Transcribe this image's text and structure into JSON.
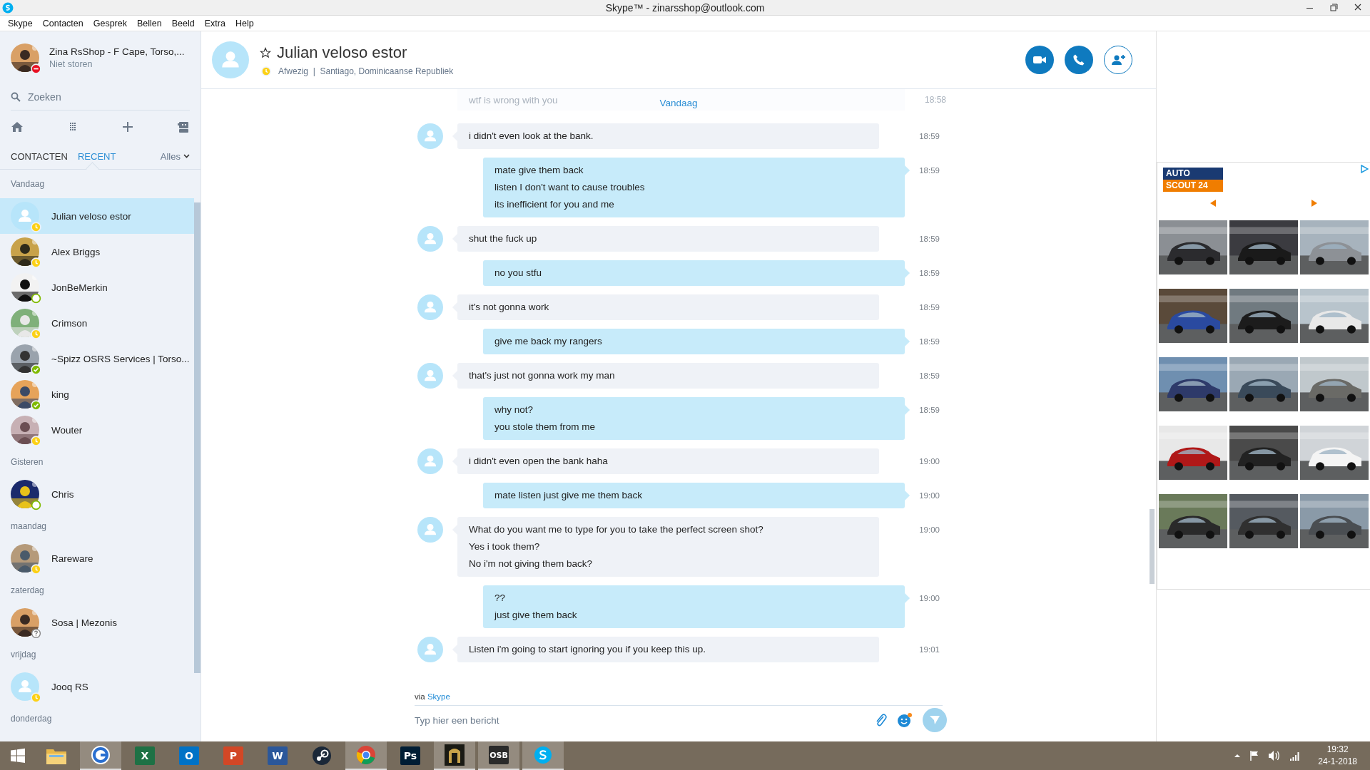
{
  "window": {
    "title": "Skype™ - zinarsshop@outlook.com"
  },
  "menu": [
    "Skype",
    "Contacten",
    "Gesprek",
    "Bellen",
    "Beeld",
    "Extra",
    "Help"
  ],
  "profile": {
    "name": "Zina RsShop - F Cape, Torso,...",
    "status_text": "Niet storen",
    "badge": {
      "kind": "dnd"
    }
  },
  "search": {
    "placeholder": "Zoeken"
  },
  "tabs": [
    {
      "label": "CONTACTEN",
      "selected": false
    },
    {
      "label": "RECENT",
      "selected": true
    }
  ],
  "filter": "Alles",
  "groups": [
    {
      "label": "Vandaag",
      "contacts": [
        {
          "name": "Julian veloso estor",
          "avatar": {
            "kind": "default"
          },
          "badge": {
            "kind": "away"
          },
          "selected": true
        },
        {
          "name": "Alex Briggs",
          "badge": {
            "kind": "away"
          },
          "selected": false
        },
        {
          "name": "JonBeMerkin",
          "badge": {
            "kind": "available"
          },
          "selected": false
        },
        {
          "name": "Crimson",
          "badge": {
            "kind": "away"
          },
          "selected": false
        },
        {
          "name": "~Spizz OSRS Services | Torso...",
          "badge": {
            "kind": "online"
          },
          "selected": false
        },
        {
          "name": "king",
          "badge": {
            "kind": "online"
          },
          "selected": false
        },
        {
          "name": "Wouter",
          "badge": {
            "kind": "away"
          },
          "selected": false
        }
      ]
    },
    {
      "label": "Gisteren",
      "contacts": [
        {
          "name": "Chris",
          "badge": {
            "kind": "available"
          },
          "selected": false
        }
      ]
    },
    {
      "label": "maandag",
      "contacts": [
        {
          "name": "Rareware",
          "badge": {
            "kind": "away"
          },
          "selected": false
        }
      ]
    },
    {
      "label": "zaterdag",
      "contacts": [
        {
          "name": "Sosa | Mezonis",
          "badge": {
            "kind": "unknown"
          },
          "selected": false
        }
      ]
    },
    {
      "label": "vrijdag",
      "contacts": [
        {
          "name": "Jooq RS",
          "avatar": {
            "kind": "default"
          },
          "badge": {
            "kind": "away"
          },
          "selected": false
        }
      ]
    },
    {
      "label": "donderdag"
    }
  ],
  "chat": {
    "name": "Julian veloso estor",
    "badge": {
      "kind": "away"
    },
    "subtitle": "Afwezig  |  Santiago, Dominicaanse Republiek",
    "faded_message": {
      "text": "wtf is wrong with you",
      "time": "18:58"
    },
    "day": "Vandaag",
    "messages": [
      {
        "kind": "incoming",
        "lines": [
          "i didn't even look at the bank."
        ],
        "time": "18:59"
      },
      {
        "kind": "outgoing",
        "lines": [
          "mate give them back",
          "listen I don't want to cause troubles",
          "its inefficient for you and me"
        ],
        "time": "18:59"
      },
      {
        "kind": "incoming",
        "lines": [
          "shut the fuck up"
        ],
        "time": "18:59"
      },
      {
        "kind": "outgoing",
        "lines": [
          "no you stfu"
        ],
        "time": "18:59"
      },
      {
        "kind": "incoming",
        "lines": [
          "it's not gonna work"
        ],
        "time": "18:59"
      },
      {
        "kind": "outgoing",
        "lines": [
          "give me back my rangers"
        ],
        "time": "18:59"
      },
      {
        "kind": "incoming",
        "lines": [
          "that's just not gonna work my man"
        ],
        "time": "18:59"
      },
      {
        "kind": "outgoing",
        "lines": [
          "why not?",
          "you stole them from me"
        ],
        "time": "18:59"
      },
      {
        "kind": "incoming",
        "lines": [
          "i didn't even open the bank haha"
        ],
        "time": "19:00"
      },
      {
        "kind": "outgoing",
        "lines": [
          "mate listen just give me them back"
        ],
        "time": "19:00"
      },
      {
        "kind": "incoming",
        "lines": [
          "What do you want me to type for you to take the perfect screen shot?",
          "Yes i took them?",
          "No i'm not giving them back?"
        ],
        "time": "19:00"
      },
      {
        "kind": "outgoing",
        "lines": [
          "??",
          "just give them back"
        ],
        "time": "19:00"
      },
      {
        "kind": "incoming",
        "lines": [
          "Listen i'm going to start ignoring you if you keep this up."
        ],
        "time": "19:01"
      }
    ],
    "via": "via",
    "via_link": "Skype",
    "compose": {
      "placeholder": "Typ hier een bericht"
    }
  },
  "ad": {
    "logo_top": "AUTO",
    "logo_bottom": "SCOUT 24"
  },
  "taskbar": {
    "apps": [
      {
        "kind": "folder",
        "selected": false
      },
      {
        "kind": "circle",
        "selected": true
      },
      {
        "kind": "tile",
        "label": "X",
        "color": "#1e7145",
        "selected": false
      },
      {
        "kind": "tile",
        "label": "O",
        "color": "#0072c6",
        "selected": false
      },
      {
        "kind": "tile",
        "label": "P",
        "color": "#d24726",
        "selected": false
      },
      {
        "kind": "tile",
        "label": "W",
        "color": "#2b579a",
        "selected": false
      },
      {
        "kind": "steam",
        "selected": false
      },
      {
        "kind": "chrome",
        "selected": true
      },
      {
        "kind": "tile",
        "label": "Ps",
        "color": "#001d34",
        "selected": false
      },
      {
        "kind": "helmet",
        "selected": true
      },
      {
        "kind": "tile",
        "label": "OSB",
        "color": "#2a2a2a",
        "selected": true
      },
      {
        "kind": "skype",
        "selected": true
      }
    ],
    "time": "19:32",
    "date": "24-1-2018"
  }
}
